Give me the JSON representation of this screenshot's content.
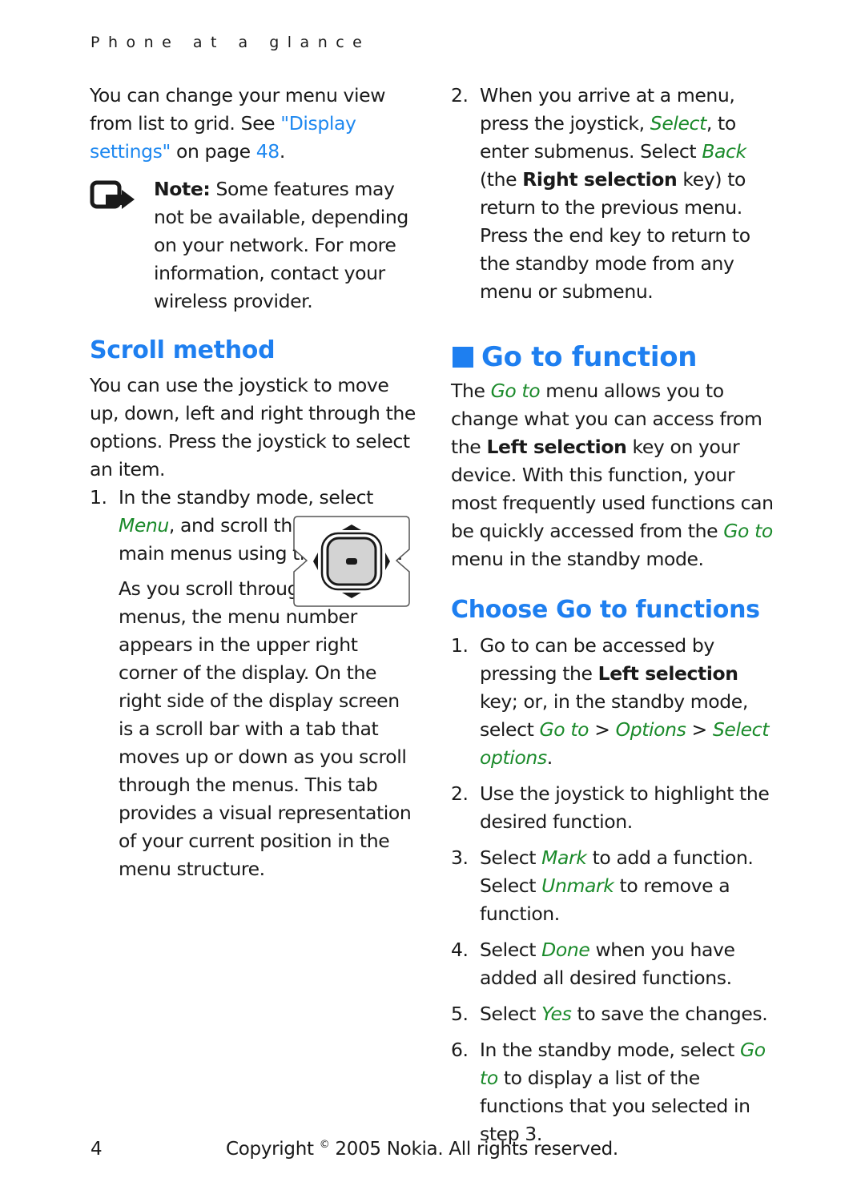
{
  "running_head": "Phone at a glance",
  "left": {
    "intro": {
      "text_before": "You can change your menu view from list to grid. See ",
      "link_text": "\"Display settings\"",
      "text_mid": " on page ",
      "page_ref": "48",
      "text_after": "."
    },
    "note": {
      "label": "Note:",
      "text": " Some features may not be available, depending on your network. For more information, contact your wireless provider.",
      "icon": "note-hand-icon"
    },
    "scroll_heading": "Scroll method",
    "scroll_para": "You can use the joystick to move up, down, left and right through the options. Press the joystick to select an item.",
    "step1": {
      "num": "1.",
      "before": "In the standby mode, select ",
      "ui": "Menu",
      "after": ", and scroll through the main menus using the joystick.",
      "continuation": "As you scroll through the menus, the menu number appears in the upper right corner of the display. On the right side of the display screen is a scroll bar with a tab that moves up or down as you scroll through the menus. This tab provides a visual representation of your current position in the menu structure."
    },
    "joystick_icon": "joystick-icon"
  },
  "right": {
    "step2": {
      "num": "2.",
      "t1": "When you arrive at a menu, press the joystick, ",
      "ui1": "Select",
      "t2": ", to enter submenus. Select ",
      "ui2": "Back",
      "t3": " (the ",
      "bold": "Right selection",
      "t4": " key) to return to the previous menu. Press the end key to return to the standby mode from any menu or submenu."
    },
    "goto_heading": "Go to function",
    "goto_para": {
      "t1": "The ",
      "ui1": "Go to",
      "t2": " menu allows you to change what you can access from the ",
      "bold": "Left selection",
      "t3": " key on your device. With this function, your most frequently used functions can be quickly accessed from the ",
      "ui2": "Go to",
      "t4": " menu in the standby mode."
    },
    "choose_heading": "Choose Go to functions",
    "steps": [
      {
        "num": "1.",
        "t1": "Go to can be accessed by pressing the ",
        "bold": "Left selection",
        "t2": " key; or, in the standby mode, select ",
        "ui1": "Go to",
        "t3": " > ",
        "ui2": "Options",
        "t4": " > ",
        "ui3": "Select options",
        "t5": "."
      },
      {
        "num": "2.",
        "text": "Use the joystick to highlight the desired function."
      },
      {
        "num": "3.",
        "t1": "Select ",
        "ui1": "Mark",
        "t2": " to add a function. Select ",
        "ui2": "Unmark",
        "t3": " to remove a function."
      },
      {
        "num": "4.",
        "t1": "Select ",
        "ui1": "Done",
        "t2": " when you have added all desired functions."
      },
      {
        "num": "5.",
        "t1": "Select ",
        "ui1": "Yes",
        "t2": " to save the changes."
      },
      {
        "num": "6.",
        "t1": "In the standby mode, select ",
        "ui1": "Go to",
        "t2": " to display a list of the functions that you selected in step 3."
      }
    ]
  },
  "footer": {
    "page_number": "4",
    "copyright_pre": "Copyright ",
    "copyright_symbol": "©",
    "copyright_post": " 2005 Nokia. All rights reserved."
  },
  "colors": {
    "heading_blue": "#1e7ff0",
    "link_blue": "#1e88f0",
    "ui_green": "#1a8a2a",
    "text": "#1a1a1a"
  }
}
